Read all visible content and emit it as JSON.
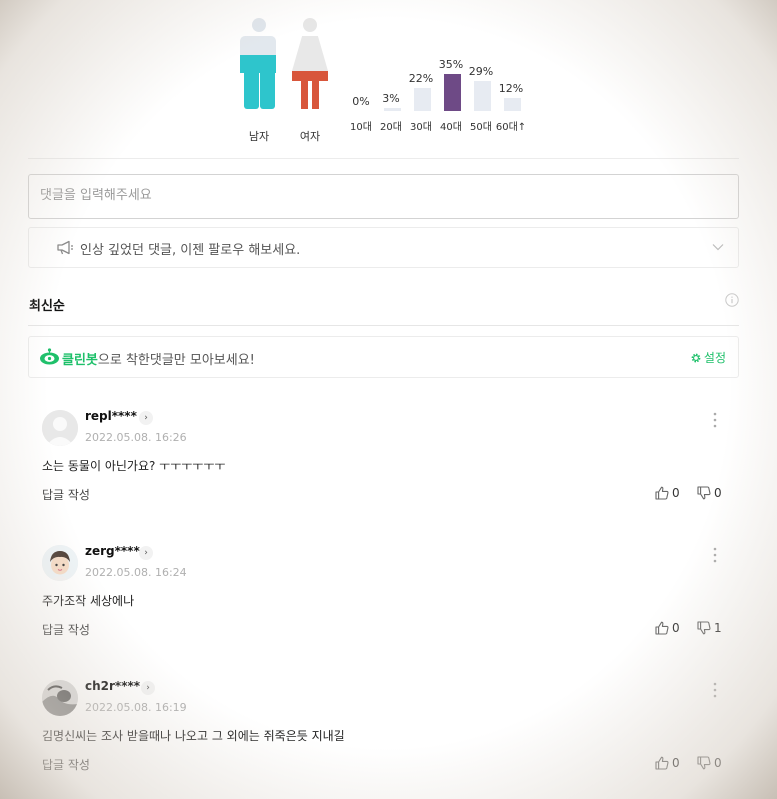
{
  "gender": {
    "male_label": "남자",
    "female_label": "여자",
    "colors": {
      "male": "#2ec5cc",
      "female": "#d8563b"
    }
  },
  "ages": [
    {
      "pct": "0%",
      "value": 0,
      "label": "10대"
    },
    {
      "pct": "3%",
      "value": 3,
      "label": "20대"
    },
    {
      "pct": "22%",
      "value": 22,
      "label": "30대"
    },
    {
      "pct": "35%",
      "value": 35,
      "label": "40대",
      "highlight": true
    },
    {
      "pct": "29%",
      "value": 29,
      "label": "50대"
    },
    {
      "pct": "12%",
      "value": 12,
      "label": "60대↑"
    }
  ],
  "comment_input": {
    "placeholder": "댓글을 입력해주세요"
  },
  "notice": {
    "text": "인상 깊었던 댓글, 이젠 팔로우 해보세요."
  },
  "sort": {
    "label": "최신순"
  },
  "cleanbot": {
    "brand": "클린봇",
    "text": "으로 착한댓글만 모아보세요!",
    "settings_label": "설정",
    "accent": "#1ec06a"
  },
  "comments": [
    {
      "nickname": "repl****",
      "date": "2022.05.08. 16:26",
      "body": "소는 동물이 아닌가요? ㅜㅜㅜㅜㅜㅜ",
      "reply_label": "답글 작성",
      "likes": "0",
      "dislikes": "0",
      "avatar": "default-avatar"
    },
    {
      "nickname": "zerg****",
      "date": "2022.05.08. 16:24",
      "body": "주가조작 세상에나",
      "reply_label": "답글 작성",
      "likes": "0",
      "dislikes": "1",
      "avatar": "cartoon-avatar"
    },
    {
      "nickname": "ch2r****",
      "date": "2022.05.08. 16:19",
      "body": "김명신씨는 조사 받을때나 나오고 그 외에는 쥐죽은듯 지내길",
      "reply_label": "답글 작성",
      "likes": "0",
      "dislikes": "0",
      "avatar": "photo-avatar"
    }
  ]
}
